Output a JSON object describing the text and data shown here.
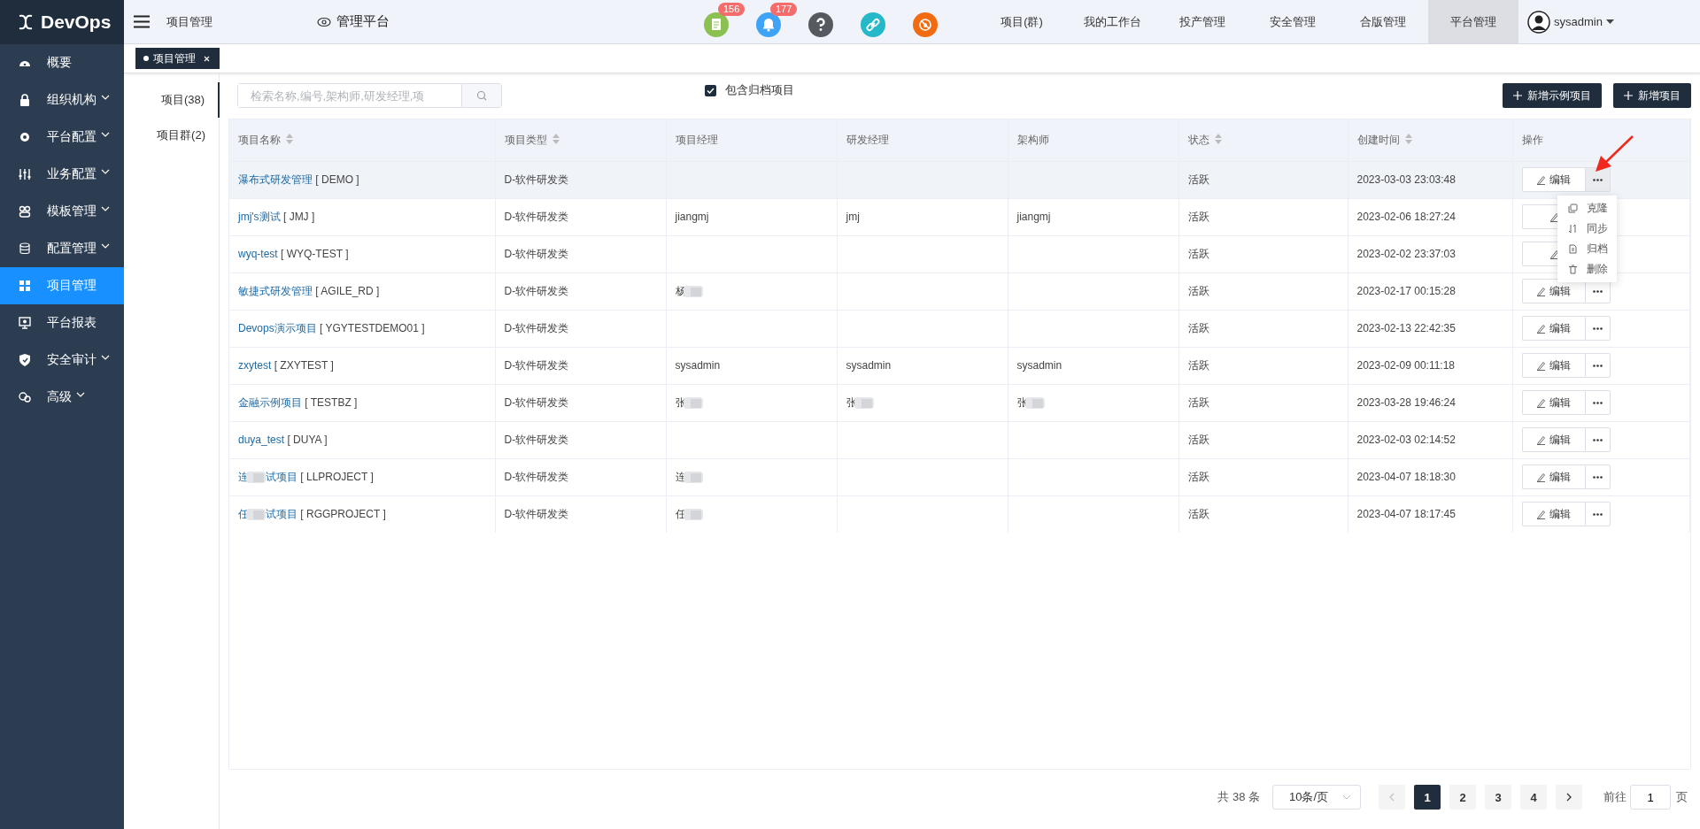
{
  "brand": "DevOps",
  "sidebar": {
    "items": [
      {
        "label": "概要",
        "expandable": false,
        "selected": false
      },
      {
        "label": "组织机构",
        "expandable": true,
        "selected": false
      },
      {
        "label": "平台配置",
        "expandable": true,
        "selected": false
      },
      {
        "label": "业务配置",
        "expandable": true,
        "selected": false
      },
      {
        "label": "模板管理",
        "expandable": true,
        "selected": false
      },
      {
        "label": "配置管理",
        "expandable": true,
        "selected": false
      },
      {
        "label": "项目管理",
        "expandable": false,
        "selected": true
      },
      {
        "label": "平台报表",
        "expandable": false,
        "selected": false
      },
      {
        "label": "安全审计",
        "expandable": true,
        "selected": false
      },
      {
        "label": "高级",
        "expandable": true,
        "selected": false
      }
    ]
  },
  "header": {
    "breadcrumb": "项目管理",
    "platform": "管理平台",
    "icons": [
      {
        "badge": "156",
        "color": "#8cc152"
      },
      {
        "badge": "177",
        "color": "#3fa4f6"
      },
      {
        "color": "#555a60"
      },
      {
        "color": "#25b8c9"
      },
      {
        "color": "#f26b10"
      }
    ],
    "nav": [
      {
        "label": "项目(群)",
        "selected": false
      },
      {
        "label": "我的工作台",
        "selected": false
      },
      {
        "label": "投产管理",
        "selected": false
      },
      {
        "label": "安全管理",
        "selected": false
      },
      {
        "label": "合版管理",
        "selected": false
      },
      {
        "label": "平台管理",
        "selected": true
      }
    ],
    "user": "sysadmin"
  },
  "open_tabs": [
    {
      "label": "项目管理",
      "selected": true
    }
  ],
  "side_tabs": [
    {
      "label": "项目(38)",
      "selected": true
    },
    {
      "label": "项目群(2)",
      "selected": false
    }
  ],
  "search": {
    "placeholder": "检索名称,编号,架构师,研发经理,项"
  },
  "include_archived": {
    "label": "包含归档项目",
    "checked": true
  },
  "buttons": [
    "新增示例项目",
    "新增项目"
  ],
  "table": {
    "columns": [
      {
        "label": "项目名称",
        "sortable": true
      },
      {
        "label": "项目类型",
        "sortable": true
      },
      {
        "label": "项目经理",
        "sortable": false
      },
      {
        "label": "研发经理",
        "sortable": false
      },
      {
        "label": "架构师",
        "sortable": false
      },
      {
        "label": "状态",
        "sortable": true
      },
      {
        "label": "创建时间",
        "sortable": true
      },
      {
        "label": "操作",
        "sortable": false
      }
    ],
    "rows": [
      {
        "hovered": true,
        "name": "瀑布式研发管理",
        "code": "[ DEMO ]",
        "type": "D-软件研发类",
        "status": "活跃",
        "created": "2023-03-03 23:03:48",
        "edit": "编辑",
        "menu_open": true
      },
      {
        "hovered": false,
        "name": "jmj's测试",
        "code": "[ JMJ ]",
        "type": "D-软件研发类",
        "pm": "jiangmj",
        "rd": "jmj",
        "arch": "jiangmj",
        "status": "活跃",
        "created": "2023-02-06 18:27:24",
        "menu_open": false,
        "covered": true
      },
      {
        "hovered": false,
        "name": "wyq-test",
        "code": "[ WYQ-TEST ]",
        "type": "D-软件研发类",
        "status": "活跃",
        "created": "2023-02-02 23:37:03",
        "menu_open": false,
        "covered": true
      },
      {
        "hovered": false,
        "name": "敏捷式研发管理",
        "code": "[ AGILE_RD ]",
        "type": "D-软件研发类",
        "pm": "杨",
        "pm_blurred": true,
        "status": "活跃",
        "created": "2023-02-17 00:15:28",
        "edit": "编辑",
        "menu_open": false
      },
      {
        "hovered": false,
        "name": "Devops演示项目",
        "code": "[ YGYTESTDEMO01 ]",
        "type": "D-软件研发类",
        "status": "活跃",
        "created": "2023-02-13 22:42:35",
        "edit": "编辑",
        "menu_open": false
      },
      {
        "hovered": false,
        "name": "zxytest",
        "code": "[ ZXYTEST ]",
        "type": "D-软件研发类",
        "pm": "sysadmin",
        "rd": "sysadmin",
        "arch": "sysadmin",
        "status": "活跃",
        "created": "2023-02-09 00:11:18",
        "edit": "编辑",
        "menu_open": false
      },
      {
        "hovered": false,
        "name": "金融示例项目",
        "code": "[ TESTBZ ]",
        "type": "D-软件研发类",
        "pm": "张",
        "pm_blurred": true,
        "rd": "张",
        "rd_blurred": true,
        "arch": "张",
        "arch_blurred": true,
        "status": "活跃",
        "created": "2023-03-28 19:46:24",
        "edit": "编辑",
        "menu_open": false
      },
      {
        "hovered": false,
        "name": "duya_test",
        "code": "[ DUYA ]",
        "type": "D-软件研发类",
        "status": "活跃",
        "created": "2023-02-03 02:14:52",
        "edit": "编辑",
        "menu_open": false
      },
      {
        "hovered": false,
        "name": "连",
        "name_blurred": true,
        "name_rest": "试项目",
        "code": "[ LLPROJECT ]",
        "type": "D-软件研发类",
        "pm": "连",
        "pm_blurred": true,
        "status": "活跃",
        "created": "2023-04-07 18:18:30",
        "edit": "编辑",
        "menu_open": false
      },
      {
        "hovered": false,
        "name": "任",
        "name_blurred": true,
        "name_rest": "试项目",
        "code": "[ RGGPROJECT ]",
        "type": "D-软件研发类",
        "pm": "任",
        "pm_blurred": true,
        "status": "活跃",
        "created": "2023-04-07 18:17:45",
        "edit": "编辑",
        "menu_open": false
      }
    ]
  },
  "more_menu": [
    {
      "label": "克隆"
    },
    {
      "label": "同步"
    },
    {
      "label": "归档"
    },
    {
      "label": "删除"
    }
  ],
  "pagination": {
    "total": "共 38 条",
    "page_size": "10条/页",
    "prev_disabled": true,
    "pages": [
      {
        "label": "1",
        "selected": true
      },
      {
        "label": "2",
        "selected": false
      },
      {
        "label": "3",
        "selected": false
      },
      {
        "label": "4",
        "selected": false
      }
    ],
    "goto_label": "前往",
    "goto_value": "1",
    "goto_suffix": "页"
  }
}
